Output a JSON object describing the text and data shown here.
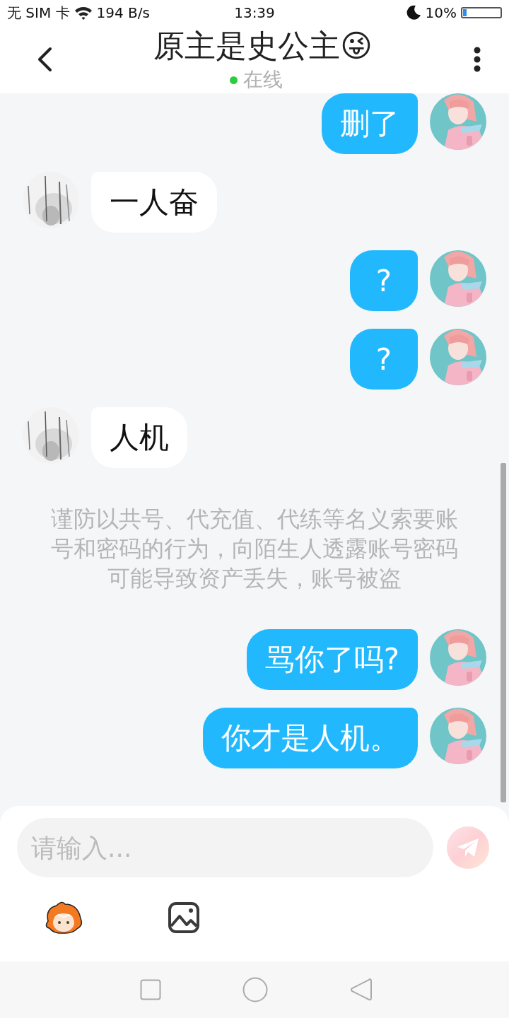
{
  "status_bar": {
    "carrier": "无 SIM 卡",
    "speed": "194 B/s",
    "time": "13:39",
    "battery": "10%"
  },
  "header": {
    "title": "原主是史公主😜",
    "status": "在线",
    "online": true
  },
  "messages": [
    {
      "kind": "sent",
      "text": "删了"
    },
    {
      "kind": "received",
      "text": "一人奋"
    },
    {
      "kind": "sent",
      "text": "?"
    },
    {
      "kind": "sent",
      "text": "?"
    },
    {
      "kind": "received",
      "text": "人机"
    },
    {
      "kind": "notice",
      "text": "谨防以共号、代充值、代练等名义索要账号和密码的行为，向陌生人透露账号密码可能导致资产丢失，账号被盗"
    },
    {
      "kind": "sent",
      "text": "骂你了吗?"
    },
    {
      "kind": "sent",
      "text": "你才是人机。"
    }
  ],
  "composer": {
    "placeholder": "请输入..."
  }
}
